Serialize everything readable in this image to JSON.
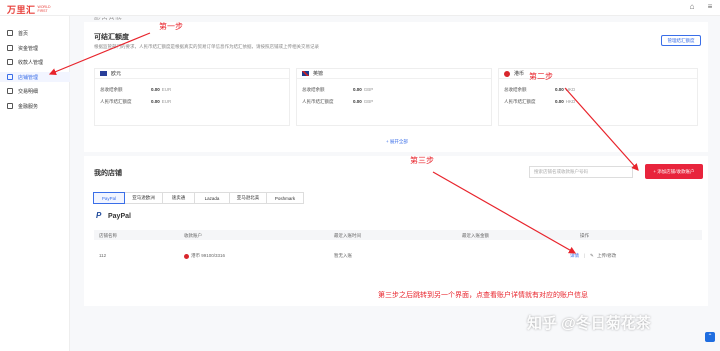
{
  "app": {
    "logo_main": "万里汇",
    "logo_sub": "WORLD FIRST"
  },
  "top_icons": [
    "gift-icon",
    "menu-icon"
  ],
  "sidebar": {
    "items": [
      {
        "label": "首页",
        "icon": "home-icon",
        "active": false
      },
      {
        "label": "资金管理",
        "icon": "wallet-icon",
        "active": false
      },
      {
        "label": "收款人管理",
        "icon": "user-icon",
        "active": false
      },
      {
        "label": "店铺管理",
        "icon": "store-icon",
        "active": true
      },
      {
        "label": "交易明细",
        "icon": "list-icon",
        "active": false
      },
      {
        "label": "金融服务",
        "icon": "finance-icon",
        "active": false
      }
    ]
  },
  "cutoff_heading": "账户总览",
  "quota": {
    "title": "可结汇额度",
    "desc": "根据监管部门的要求，人民币结汇额度是根据真实的贸易订单信息作为结汇依据，请按照店铺或上传相关交易记录",
    "manage_button": "管理结汇额度",
    "expand": "+ 展开全部",
    "currencies": [
      {
        "name": "欧元",
        "flag": "eu-flag",
        "available_label": "总收结余额",
        "available_value": "0.00",
        "unit": "EUR",
        "rmb_label": "人民币结汇额度",
        "rmb_value": "0.00",
        "rmb_unit": "EUR"
      },
      {
        "name": "英镑",
        "flag": "uk-flag",
        "available_label": "总收结余额",
        "available_value": "0.00",
        "unit": "GBP",
        "rmb_label": "人民币结汇额度",
        "rmb_value": "0.00",
        "rmb_unit": "GBP"
      },
      {
        "name": "港币",
        "flag": "hk-flag",
        "available_label": "总收结余额",
        "available_value": "0.00",
        "unit": "HKD",
        "rmb_label": "人民币结汇额度",
        "rmb_value": "0.00",
        "rmb_unit": "HKD"
      }
    ]
  },
  "stores": {
    "title": "我的店铺",
    "search_placeholder": "搜索店铺名或收款账户号码",
    "add_button": "+ 添加店铺/收款账户",
    "tabs": [
      "PayPal",
      "亚马逊欧洲",
      "速卖通",
      "Lazada",
      "亚马逊北美",
      "Poshmark"
    ],
    "active_tab": "PayPal",
    "platform": "PayPal",
    "columns": [
      "店铺名称",
      "收款账户",
      "最近入账时间",
      "最近入账金额",
      "操作"
    ],
    "row": {
      "store": "112",
      "account": "港币 99100/3316",
      "last_time": "暂无入账",
      "detail_link": "详情",
      "upload_link": "上传/修改"
    }
  },
  "annotations": {
    "step1": "第一步",
    "step2": "第二步",
    "step3": "第三步",
    "note": "第三步之后跳转到另一个界面，点查看账户详情就有对应的账户信息"
  },
  "watermark": "知乎 @冬日菊花茶",
  "colors": {
    "accent": "#3a6ee8",
    "brand": "#e8413c",
    "primary_button": "#e8243c",
    "annotation": "#e8242c"
  }
}
